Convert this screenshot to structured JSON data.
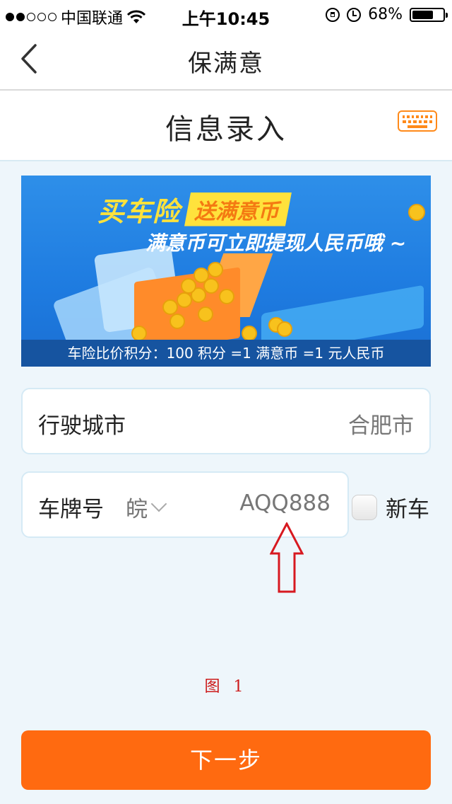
{
  "status_bar": {
    "carrier": "中国联通",
    "time": "上午10:45",
    "battery_text": "68%",
    "battery_level": 0.68
  },
  "nav": {
    "title": "保满意"
  },
  "section": {
    "title": "信息录入"
  },
  "banner": {
    "headline_main": "买车险",
    "headline_tag": "送满意币",
    "subline": "满意币可立即提现人民币哦 ~",
    "footer": "车险比价积分：100 积分 =1 满意币 =1 元人民币"
  },
  "form": {
    "city_label": "行驶城市",
    "city_value": "合肥市",
    "plate_label": "车牌号",
    "plate_province": "皖",
    "plate_number": "AQQ888",
    "new_car_label": "新车",
    "new_car_checked": false
  },
  "annotation": {
    "caption": "图 1"
  },
  "actions": {
    "next_label": "下一步"
  },
  "colors": {
    "accent": "#ff6a10",
    "keyboard_icon": "#ff8a1a",
    "annotation": "#cc1a1a",
    "background": "#eef6fb"
  },
  "icons": [
    "back-chevron-icon",
    "keyboard-icon",
    "wifi-icon",
    "rotation-lock-icon",
    "alarm-icon",
    "battery-icon",
    "dropdown-chevron-icon",
    "annotation-arrow-icon"
  ]
}
